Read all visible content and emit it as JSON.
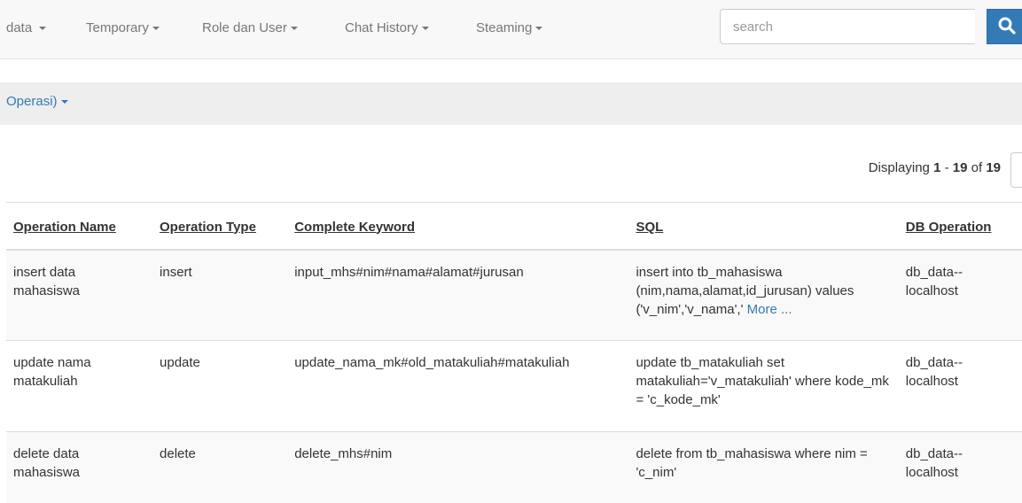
{
  "navbar": {
    "menus": [
      {
        "label": "data"
      },
      {
        "label": "Temporary"
      },
      {
        "label": "Role dan User"
      },
      {
        "label": "Chat History"
      },
      {
        "label": "Steaming"
      }
    ],
    "search": {
      "placeholder": "search",
      "button_icon": "search-icon"
    }
  },
  "subnav": {
    "label": "Operasi)"
  },
  "summary": {
    "prefix": "Displaying ",
    "from": "1",
    "sep": " - ",
    "to": "19",
    "of_word": " of ",
    "total": "19"
  },
  "table": {
    "headers": [
      "Operation Name",
      "Operation Type",
      "Complete Keyword",
      "SQL",
      "DB Operation"
    ],
    "rows": [
      {
        "name": "insert data mahasiswa",
        "type": "insert",
        "keyword": "input_mhs#nim#nama#alamat#jurusan",
        "sql": "insert into tb_mahasiswa (nim,nama,alamat,id_jurusan) values ('v_nim','v_nama','",
        "more": "More ...",
        "db": "db_data--localhost"
      },
      {
        "name": "update nama matakuliah",
        "type": "update",
        "keyword": "update_nama_mk#old_matakuliah#matakuliah",
        "sql": "update tb_matakuliah set matakuliah='v_matakuliah' where kode_mk = 'c_kode_mk'",
        "more": "",
        "db": "db_data--localhost"
      },
      {
        "name": "delete data mahasiswa",
        "type": "delete",
        "keyword": "delete_mhs#nim",
        "sql": "delete from tb_mahasiswa where nim = 'c_nim'",
        "more": "",
        "db": "db_data--localhost"
      }
    ]
  }
}
